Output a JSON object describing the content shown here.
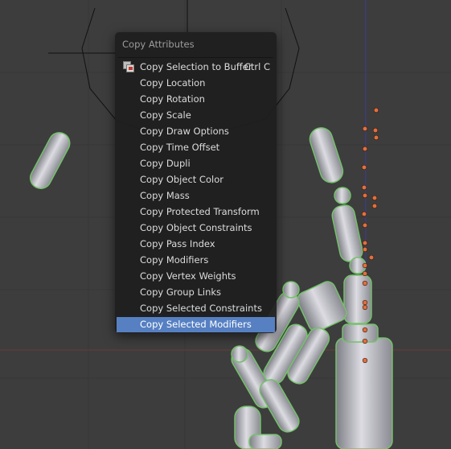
{
  "menu": {
    "title": "Copy Attributes",
    "items": [
      {
        "label": "Copy Selection to Buffer",
        "shortcut": "Ctrl C",
        "icon": "copy-buffer-icon"
      },
      {
        "label": "Copy Location"
      },
      {
        "label": "Copy Rotation"
      },
      {
        "label": "Copy Scale"
      },
      {
        "label": "Copy Draw Options"
      },
      {
        "label": "Copy Time Offset"
      },
      {
        "label": "Copy Dupli"
      },
      {
        "label": "Copy Object Color"
      },
      {
        "label": "Copy Mass"
      },
      {
        "label": "Copy Protected Transform"
      },
      {
        "label": "Copy Object Constraints"
      },
      {
        "label": "Copy Pass Index"
      },
      {
        "label": "Copy Modifiers"
      },
      {
        "label": "Copy Vertex Weights"
      },
      {
        "label": "Copy Group Links"
      },
      {
        "label": "Copy Selected Constraints"
      },
      {
        "label": "Copy Selected Modifiers",
        "highlighted": true
      }
    ]
  },
  "colors": {
    "viewport_bg": "#3d3d3d",
    "grid": "#373737",
    "x_axis": "#6a3a3a",
    "z_axis": "#3a3a9a",
    "mesh": "#c4c4cc",
    "selection_outline": "#74c26a",
    "bone_joint": "#e07040",
    "menu_highlight": "#5680c2"
  }
}
